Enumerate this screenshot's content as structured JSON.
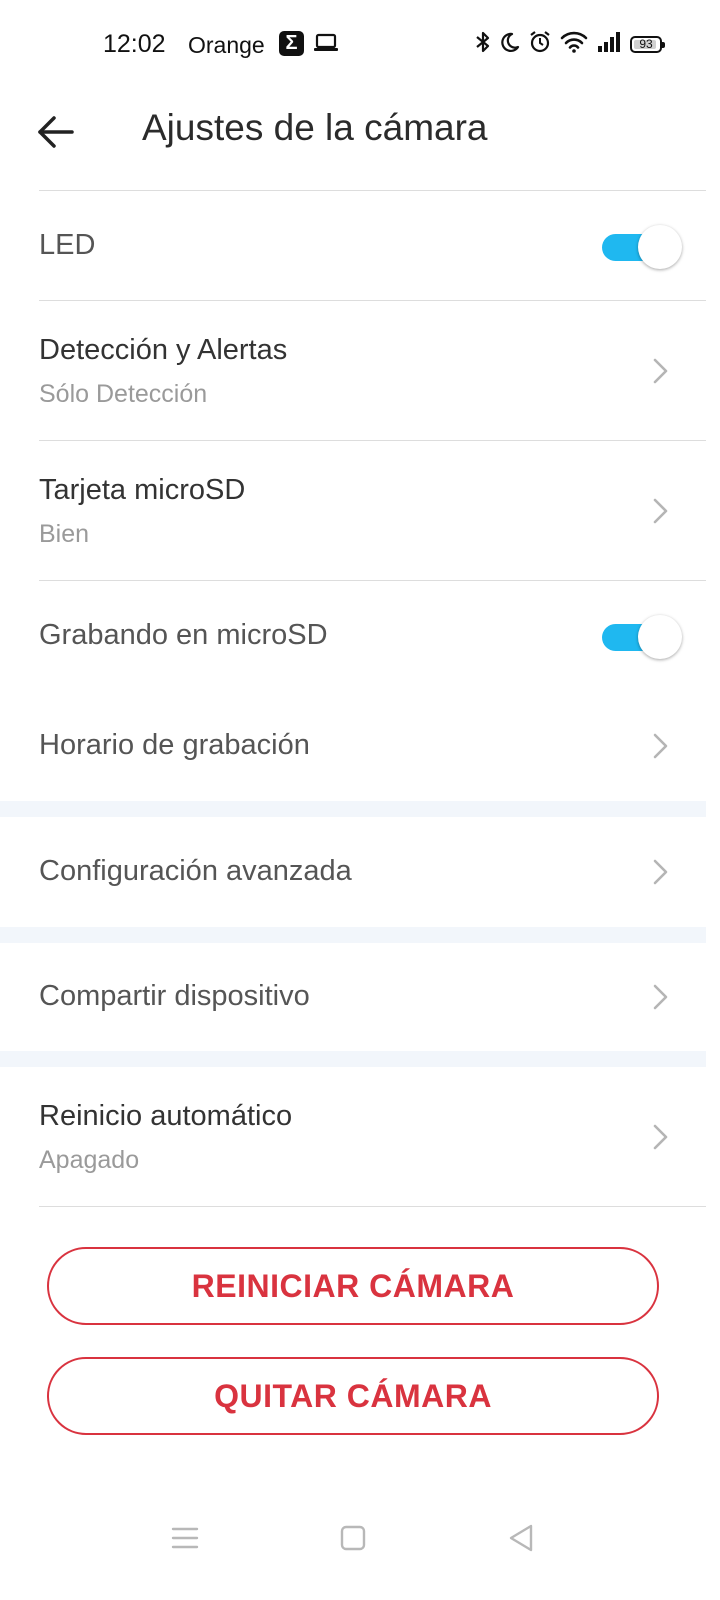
{
  "status_bar": {
    "time": "12:02",
    "carrier": "Orange",
    "battery": "93",
    "battery_level": 0.93,
    "icons": [
      "sigma-app-icon",
      "laptop-icon",
      "bluetooth-icon",
      "moon-icon",
      "alarm-icon",
      "wifi-icon",
      "signal-icon",
      "battery-icon"
    ]
  },
  "header": {
    "title": "Ajustes de la cámara",
    "back_icon": "arrow-left-icon"
  },
  "settings": {
    "led": {
      "label": "LED",
      "enabled": true
    },
    "detection": {
      "label": "Detección y Alertas",
      "value": "Sólo Detección"
    },
    "microsd": {
      "label": "Tarjeta microSD",
      "value": "Bien"
    },
    "recording": {
      "label": "Grabando en microSD",
      "enabled": true
    },
    "schedule": {
      "label": "Horario de grabación"
    },
    "advanced": {
      "label": "Configuración avanzada"
    },
    "share": {
      "label": "Compartir dispositivo"
    },
    "auto_restart": {
      "label": "Reinicio automático",
      "value": "Apagado"
    }
  },
  "buttons": {
    "restart": "REINICIAR CÁMARA",
    "remove": "QUITAR CÁMARA"
  },
  "colors": {
    "accent": "#1fb8f0",
    "danger": "#d9333f",
    "band": "#f2f6fb"
  }
}
